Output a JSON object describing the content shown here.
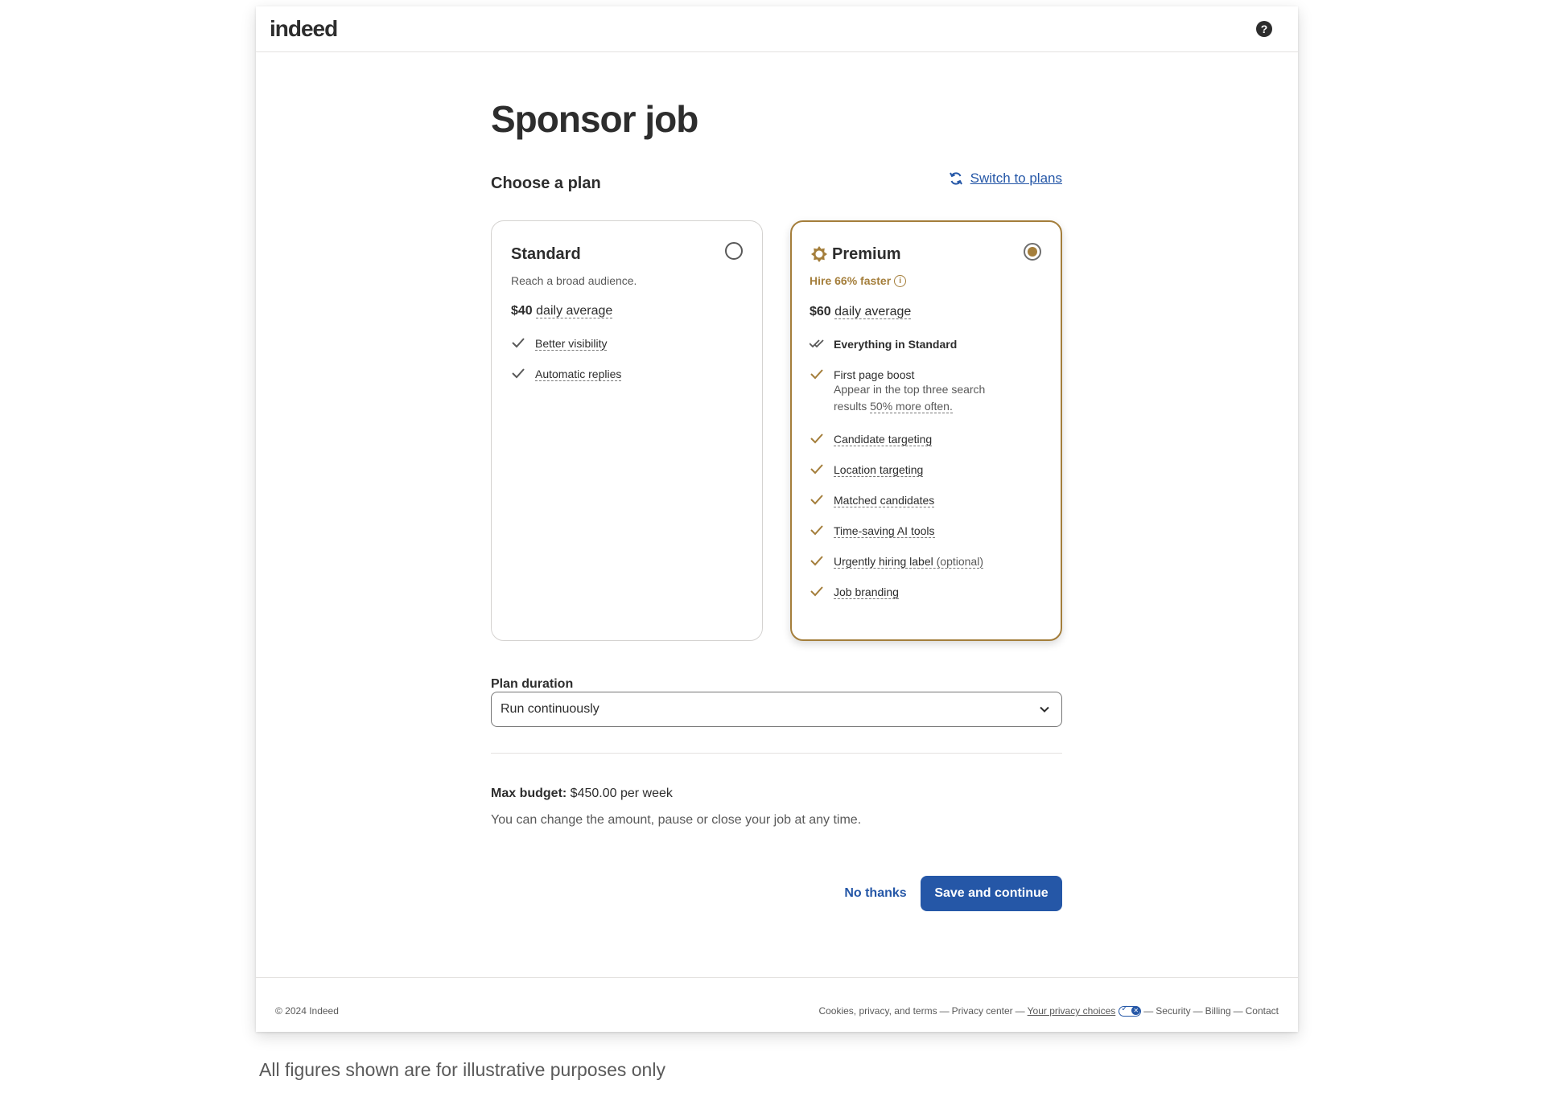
{
  "header": {
    "logo": "indeed",
    "help_icon": "question-circle"
  },
  "page": {
    "title": "Sponsor job"
  },
  "plan_section": {
    "title": "Choose a plan",
    "switch_link": "Switch to plans",
    "switch_icon": "refresh-arrows"
  },
  "plans": {
    "standard": {
      "name": "Standard",
      "description": "Reach a broad audience.",
      "price": "$40",
      "price_suffix": "daily average",
      "selected": false,
      "features": [
        "Better visibility",
        "Automatic replies"
      ]
    },
    "premium": {
      "name": "Premium",
      "tagline": "Hire 66% faster",
      "price": "$60",
      "price_suffix": "daily average",
      "selected": true,
      "features": {
        "everything": "Everything in Standard",
        "boost_title": "First page boost",
        "boost_desc_1": "Appear in the top three search results ",
        "boost_desc_2": "50% more often.",
        "f1": "Candidate targeting",
        "f2": "Location targeting",
        "f3": "Matched candidates",
        "f4": "Time-saving AI tools",
        "f5": "Urgently hiring label",
        "f5_suffix": " (optional)",
        "f6": "Job branding"
      }
    }
  },
  "duration": {
    "label": "Plan duration",
    "value": "Run continuously"
  },
  "budget": {
    "label": "Max  budget:",
    "value": " $450.00 per week",
    "note": "You can change the amount, pause or close your job at any time."
  },
  "actions": {
    "no_thanks": "No thanks",
    "save": "Save and continue"
  },
  "footer": {
    "copyright": "© 2024 Indeed",
    "links": {
      "terms": "Cookies, privacy, and terms",
      "privacy_center": "Privacy center",
      "privacy_choices": "Your privacy choices",
      "security": "Security",
      "billing": "Billing",
      "contact": "Contact"
    },
    "separator": "—"
  },
  "disclaimer": "All figures shown are for illustrative purposes only",
  "colors": {
    "brand_blue": "#2557a7",
    "premium_gold": "#a47e3b",
    "text": "#2d2d2d",
    "muted": "#595959"
  }
}
